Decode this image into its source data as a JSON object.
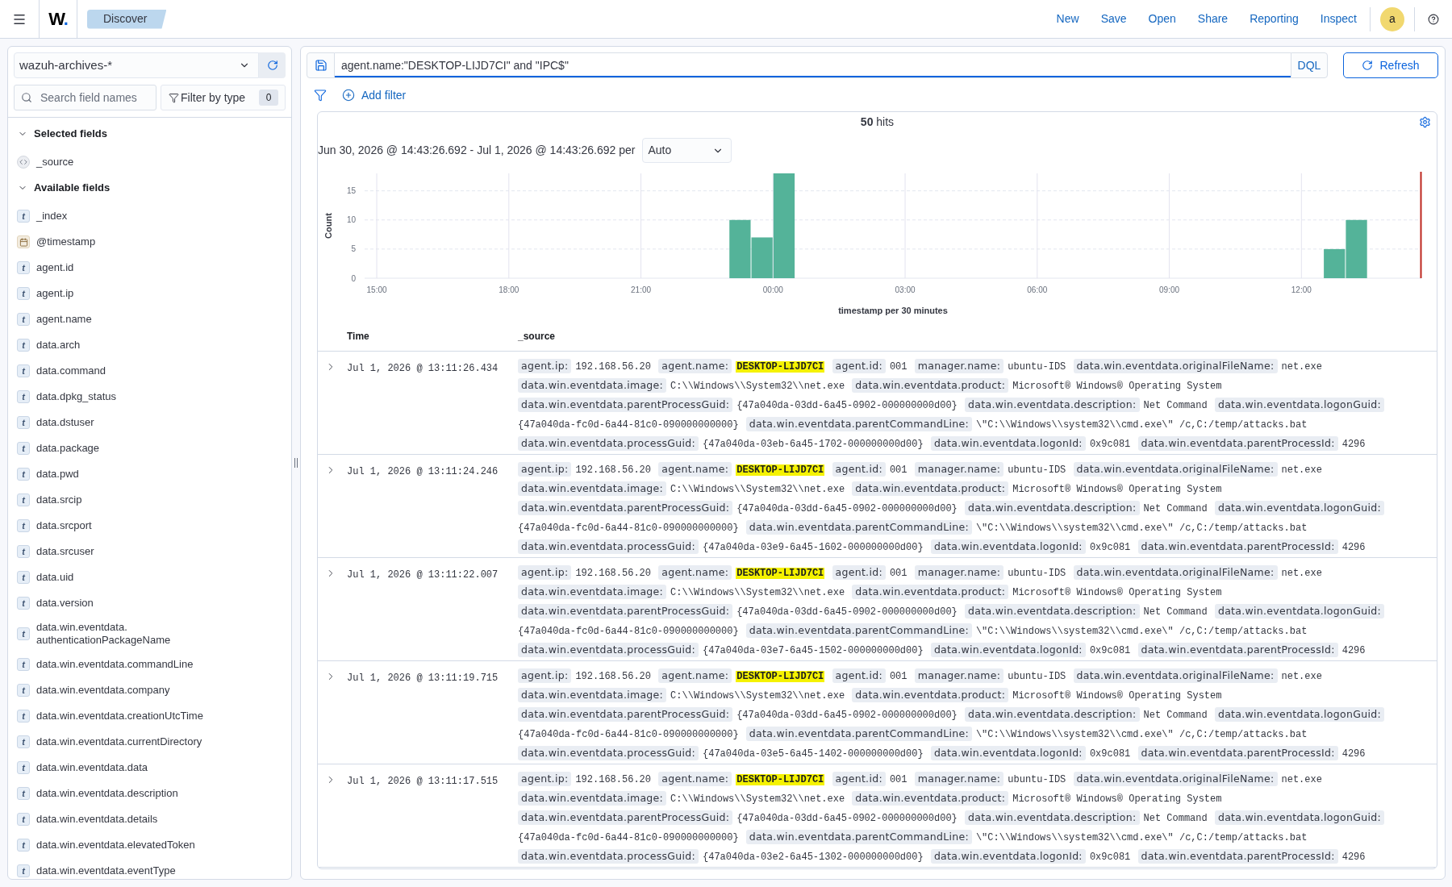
{
  "top_bar": {
    "logo": "W.",
    "breadcrumb": "Discover",
    "links": [
      "New",
      "Save",
      "Open",
      "Share",
      "Reporting",
      "Inspect"
    ],
    "avatar": "a"
  },
  "sidebar": {
    "index_pattern": "wazuh-archives-*",
    "search": {
      "placeholder": "Search field names"
    },
    "type_filter": {
      "label": "Filter by type",
      "count": "0"
    },
    "sections": [
      {
        "title": "Selected fields",
        "expanded": true,
        "fields": [
          {
            "name": "_source",
            "kind": "source"
          }
        ]
      },
      {
        "title": "Available fields",
        "expanded": true,
        "fields": [
          {
            "name": "_index",
            "kind": "string",
            "token": "t"
          },
          {
            "name": "@timestamp",
            "kind": "date"
          },
          {
            "name": "agent.id",
            "kind": "string",
            "token": "t"
          },
          {
            "name": "agent.ip",
            "kind": "string",
            "token": "t"
          },
          {
            "name": "agent.name",
            "kind": "string",
            "token": "t"
          },
          {
            "name": "data.arch",
            "kind": "string",
            "token": "t"
          },
          {
            "name": "data.command",
            "kind": "string",
            "token": "t"
          },
          {
            "name": "data.dpkg_status",
            "kind": "string",
            "token": "t"
          },
          {
            "name": "data.dstuser",
            "kind": "string",
            "token": "t"
          },
          {
            "name": "data.package",
            "kind": "string",
            "token": "t"
          },
          {
            "name": "data.pwd",
            "kind": "string",
            "token": "t"
          },
          {
            "name": "data.srcip",
            "kind": "string",
            "token": "t"
          },
          {
            "name": "data.srcport",
            "kind": "string",
            "token": "t"
          },
          {
            "name": "data.srcuser",
            "kind": "string",
            "token": "t"
          },
          {
            "name": "data.uid",
            "kind": "string",
            "token": "t"
          },
          {
            "name": "data.version",
            "kind": "string",
            "token": "t"
          },
          {
            "name": "data.win.eventdata.authenticationPackageName",
            "kind": "string",
            "token": "t"
          },
          {
            "name": "data.win.eventdata.commandLine",
            "kind": "string",
            "token": "t"
          },
          {
            "name": "data.win.eventdata.company",
            "kind": "string",
            "token": "t"
          },
          {
            "name": "data.win.eventdata.creationUtcTime",
            "kind": "string",
            "token": "t"
          },
          {
            "name": "data.win.eventdata.currentDirectory",
            "kind": "string",
            "token": "t"
          },
          {
            "name": "data.win.eventdata.data",
            "kind": "string",
            "token": "t"
          },
          {
            "name": "data.win.eventdata.description",
            "kind": "string",
            "token": "t"
          },
          {
            "name": "data.win.eventdata.details",
            "kind": "string",
            "token": "t"
          },
          {
            "name": "data.win.eventdata.elevatedToken",
            "kind": "string",
            "token": "t"
          },
          {
            "name": "data.win.eventdata.eventType",
            "kind": "string",
            "token": "t"
          }
        ]
      }
    ]
  },
  "query_bar": {
    "query": "agent.name:\"DESKTOP-LIJD7CI\" and \"IPC$\"",
    "language": "DQL",
    "refresh": "Refresh"
  },
  "filters": {
    "add_filter": "Add filter"
  },
  "results": {
    "hits": "**50** hits",
    "time_range": "Jun 30, 2026 @ 14:43:26.692 - Jul 1, 2026 @ 14:43:26.692 per",
    "interval": "Auto",
    "chart_data": {
      "type": "bar",
      "xlabel": "timestamp per 30 minutes",
      "ylabel": "Count",
      "x": [
        "2026-06-30T23:15:00",
        "2026-06-30T23:45:00",
        "2026-07-01T00:15:00",
        "2026-07-01T12:45:00",
        "2026-07-01T13:15:00"
      ],
      "values": [
        10,
        7,
        18,
        5,
        10
      ],
      "xlim": [
        "2026-06-30T14:43:26.692",
        "2026-07-01T14:43:26.692"
      ],
      "ylim": [
        0,
        18
      ],
      "xticks": [
        {
          "value": "2026-06-30T15:00:00",
          "label": "15:00"
        },
        {
          "value": "2026-06-30T18:00:00",
          "label": "18:00"
        },
        {
          "value": "2026-06-30T21:00:00",
          "label": "21:00"
        },
        {
          "value": "2026-07-01T00:00:00",
          "label": "00:00"
        },
        {
          "value": "2026-07-01T03:00:00",
          "label": "03:00"
        },
        {
          "value": "2026-07-01T06:00:00",
          "label": "06:00"
        },
        {
          "value": "2026-07-01T09:00:00",
          "label": "09:00"
        },
        {
          "value": "2026-07-01T12:00:00",
          "label": "12:00"
        }
      ],
      "yticks": [
        {
          "value": 0,
          "label": "0"
        },
        5,
        10,
        15
      ],
      "grid": true
    },
    "table": {
      "columns": [
        "Time",
        "_source"
      ],
      "rows": [
        {
          "time": "Jul 1, 2026 @ 13:11:26.434",
          "expanded": false,
          "fields": [
            {
              "key": "agent.ip:",
              "value": "192.168.56.20",
              "highlighted": false
            },
            {
              "key": "agent.name:",
              "value": "DESKTOP-LIJD7CI",
              "highlighted": true
            },
            {
              "key": "agent.id:",
              "value": "001",
              "highlighted": false
            },
            {
              "key": "manager.name:",
              "value": "ubuntu-IDS",
              "highlighted": false
            },
            {
              "key": "data.win.eventdata.originalFileName:",
              "value": "net.exe",
              "highlighted": false
            },
            {
              "key": "data.win.eventdata.image:",
              "value": "C:\\\\Windows\\\\System32\\\\net.exe",
              "highlighted": false
            },
            {
              "key": "data.win.eventdata.product:",
              "value": "Microsoft® Windows® Operating System",
              "highlighted": false
            },
            {
              "key": "data.win.eventdata.parentProcessGuid:",
              "value": "{47a040da-03dd-6a45-0902-000000000d00}",
              "highlighted": false
            },
            {
              "key": "data.win.eventdata.description:",
              "value": "Net Command",
              "highlighted": false
            },
            {
              "key": "data.win.eventdata.logonGuid:",
              "value": "{47a040da-fc0d-6a44-81c0-090000000000}",
              "highlighted": false
            },
            {
              "key": "data.win.eventdata.parentCommandLine:",
              "value": "\\\"C:\\\\Windows\\\\system32\\\\cmd.exe\\\" /c,C:/temp/attacks.bat",
              "highlighted": false
            },
            {
              "key": "data.win.eventdata.processGuid:",
              "value": "{47a040da-03eb-6a45-1702-000000000d00}",
              "highlighted": false
            },
            {
              "key": "data.win.eventdata.logonId:",
              "value": "0x9c081",
              "highlighted": false
            },
            {
              "key": "data.win.eventdata.parentProcessId:",
              "value": "4296",
              "highlighted": false
            }
          ]
        },
        {
          "time": "Jul 1, 2026 @ 13:11:24.246",
          "expanded": false,
          "fields": [
            {
              "key": "agent.ip:",
              "value": "192.168.56.20",
              "highlighted": false
            },
            {
              "key": "agent.name:",
              "value": "DESKTOP-LIJD7CI",
              "highlighted": true
            },
            {
              "key": "agent.id:",
              "value": "001",
              "highlighted": false
            },
            {
              "key": "manager.name:",
              "value": "ubuntu-IDS",
              "highlighted": false
            },
            {
              "key": "data.win.eventdata.originalFileName:",
              "value": "net.exe",
              "highlighted": false
            },
            {
              "key": "data.win.eventdata.image:",
              "value": "C:\\\\Windows\\\\System32\\\\net.exe",
              "highlighted": false
            },
            {
              "key": "data.win.eventdata.product:",
              "value": "Microsoft® Windows® Operating System",
              "highlighted": false
            },
            {
              "key": "data.win.eventdata.parentProcessGuid:",
              "value": "{47a040da-03dd-6a45-0902-000000000d00}",
              "highlighted": false
            },
            {
              "key": "data.win.eventdata.description:",
              "value": "Net Command",
              "highlighted": false
            },
            {
              "key": "data.win.eventdata.logonGuid:",
              "value": "{47a040da-fc0d-6a44-81c0-090000000000}",
              "highlighted": false
            },
            {
              "key": "data.win.eventdata.parentCommandLine:",
              "value": "\\\"C:\\\\Windows\\\\system32\\\\cmd.exe\\\" /c,C:/temp/attacks.bat",
              "highlighted": false
            },
            {
              "key": "data.win.eventdata.processGuid:",
              "value": "{47a040da-03e9-6a45-1602-000000000d00}",
              "highlighted": false
            },
            {
              "key": "data.win.eventdata.logonId:",
              "value": "0x9c081",
              "highlighted": false
            },
            {
              "key": "data.win.eventdata.parentProcessId:",
              "value": "4296",
              "highlighted": false
            }
          ]
        },
        {
          "time": "Jul 1, 2026 @ 13:11:22.007",
          "expanded": false,
          "fields": [
            {
              "key": "agent.ip:",
              "value": "192.168.56.20",
              "highlighted": false
            },
            {
              "key": "agent.name:",
              "value": "DESKTOP-LIJD7CI",
              "highlighted": true
            },
            {
              "key": "agent.id:",
              "value": "001",
              "highlighted": false
            },
            {
              "key": "manager.name:",
              "value": "ubuntu-IDS",
              "highlighted": false
            },
            {
              "key": "data.win.eventdata.originalFileName:",
              "value": "net.exe",
              "highlighted": false
            },
            {
              "key": "data.win.eventdata.image:",
              "value": "C:\\\\Windows\\\\System32\\\\net.exe",
              "highlighted": false
            },
            {
              "key": "data.win.eventdata.product:",
              "value": "Microsoft® Windows® Operating System",
              "highlighted": false
            },
            {
              "key": "data.win.eventdata.parentProcessGuid:",
              "value": "{47a040da-03dd-6a45-0902-000000000d00}",
              "highlighted": false
            },
            {
              "key": "data.win.eventdata.description:",
              "value": "Net Command",
              "highlighted": false
            },
            {
              "key": "data.win.eventdata.logonGuid:",
              "value": "{47a040da-fc0d-6a44-81c0-090000000000}",
              "highlighted": false
            },
            {
              "key": "data.win.eventdata.parentCommandLine:",
              "value": "\\\"C:\\\\Windows\\\\system32\\\\cmd.exe\\\" /c,C:/temp/attacks.bat",
              "highlighted": false
            },
            {
              "key": "data.win.eventdata.processGuid:",
              "value": "{47a040da-03e7-6a45-1502-000000000d00}",
              "highlighted": false
            },
            {
              "key": "data.win.eventdata.logonId:",
              "value": "0x9c081",
              "highlighted": false
            },
            {
              "key": "data.win.eventdata.parentProcessId:",
              "value": "4296",
              "highlighted": false
            }
          ]
        },
        {
          "time": "Jul 1, 2026 @ 13:11:19.715",
          "expanded": false,
          "fields": [
            {
              "key": "agent.ip:",
              "value": "192.168.56.20",
              "highlighted": false
            },
            {
              "key": "agent.name:",
              "value": "DESKTOP-LIJD7CI",
              "highlighted": true
            },
            {
              "key": "agent.id:",
              "value": "001",
              "highlighted": false
            },
            {
              "key": "manager.name:",
              "value": "ubuntu-IDS",
              "highlighted": false
            },
            {
              "key": "data.win.eventdata.originalFileName:",
              "value": "net.exe",
              "highlighted": false
            },
            {
              "key": "data.win.eventdata.image:",
              "value": "C:\\\\Windows\\\\System32\\\\net.exe",
              "highlighted": false
            },
            {
              "key": "data.win.eventdata.product:",
              "value": "Microsoft® Windows® Operating System",
              "highlighted": false
            },
            {
              "key": "data.win.eventdata.parentProcessGuid:",
              "value": "{47a040da-03dd-6a45-0902-000000000d00}",
              "highlighted": false
            },
            {
              "key": "data.win.eventdata.description:",
              "value": "Net Command",
              "highlighted": false
            },
            {
              "key": "data.win.eventdata.logonGuid:",
              "value": "{47a040da-fc0d-6a44-81c0-090000000000}",
              "highlighted": false
            },
            {
              "key": "data.win.eventdata.parentCommandLine:",
              "value": "\\\"C:\\\\Windows\\\\system32\\\\cmd.exe\\\" /c,C:/temp/attacks.bat",
              "highlighted": false
            },
            {
              "key": "data.win.eventdata.processGuid:",
              "value": "{47a040da-03e5-6a45-1402-000000000d00}",
              "highlighted": false
            },
            {
              "key": "data.win.eventdata.logonId:",
              "value": "0x9c081",
              "highlighted": false
            },
            {
              "key": "data.win.eventdata.parentProcessId:",
              "value": "4296",
              "highlighted": false
            }
          ]
        },
        {
          "time": "Jul 1, 2026 @ 13:11:17.515",
          "expanded": false,
          "fields": [
            {
              "key": "agent.ip:",
              "value": "192.168.56.20",
              "highlighted": false
            },
            {
              "key": "agent.name:",
              "value": "DESKTOP-LIJD7CI",
              "highlighted": true
            },
            {
              "key": "agent.id:",
              "value": "001",
              "highlighted": false
            },
            {
              "key": "manager.name:",
              "value": "ubuntu-IDS",
              "highlighted": false
            },
            {
              "key": "data.win.eventdata.originalFileName:",
              "value": "net.exe",
              "highlighted": false
            },
            {
              "key": "data.win.eventdata.image:",
              "value": "C:\\\\Windows\\\\System32\\\\net.exe",
              "highlighted": false
            },
            {
              "key": "data.win.eventdata.product:",
              "value": "Microsoft® Windows® Operating System",
              "highlighted": false
            },
            {
              "key": "data.win.eventdata.parentProcessGuid:",
              "value": "{47a040da-03dd-6a45-0902-000000000d00}",
              "highlighted": false
            },
            {
              "key": "data.win.eventdata.description:",
              "value": "Net Command",
              "highlighted": false
            },
            {
              "key": "data.win.eventdata.logonGuid:",
              "value": "{47a040da-fc0d-6a44-81c0-090000000000}",
              "highlighted": false
            },
            {
              "key": "data.win.eventdata.parentCommandLine:",
              "value": "\\\"C:\\\\Windows\\\\system32\\\\cmd.exe\\\" /c,C:/temp/attacks.bat",
              "highlighted": false
            },
            {
              "key": "data.win.eventdata.processGuid:",
              "value": "{47a040da-03e2-6a45-1302-000000000d00}",
              "highlighted": false
            },
            {
              "key": "data.win.eventdata.logonId:",
              "value": "0x9c081",
              "highlighted": false
            },
            {
              "key": "data.win.eventdata.parentProcessId:",
              "value": "4296",
              "highlighted": false
            }
          ]
        }
      ]
    }
  }
}
